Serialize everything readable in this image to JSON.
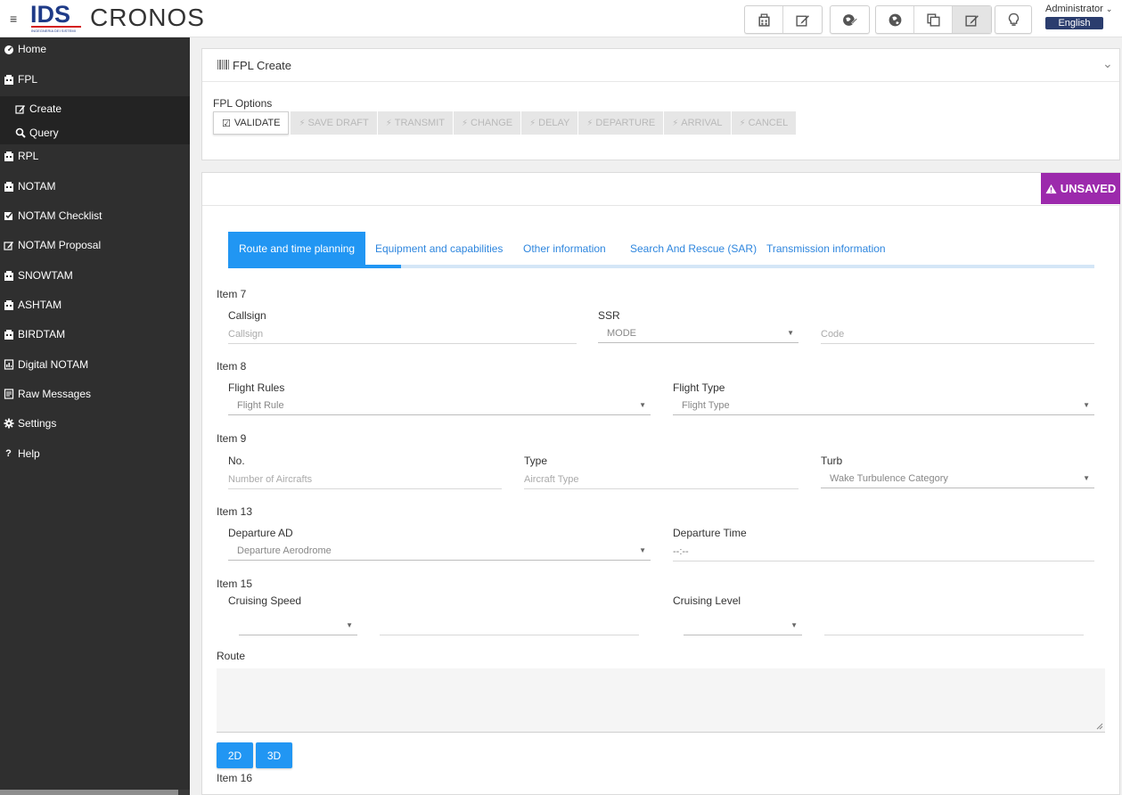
{
  "header": {
    "brand_short": "IDS",
    "brand_sub": "INGEGNERIA DEI SISTEMI",
    "app_name": "CRONOS",
    "user": "Administrator",
    "language": "English",
    "toolbar_icons": [
      "fpl-icon",
      "edit-icon",
      "globe-edit-icon",
      "globe-icon",
      "copy-icon",
      "edit-active-icon",
      "lightbulb-icon"
    ]
  },
  "sidebar": {
    "items": [
      {
        "label": "Home",
        "icon": "dashboard-icon"
      },
      {
        "label": "FPL",
        "icon": "fpl-icon"
      },
      {
        "label": "Create",
        "icon": "edit-icon"
      },
      {
        "label": "Query",
        "icon": "search-icon"
      },
      {
        "label": "RPL",
        "icon": "fpl-icon"
      },
      {
        "label": "NOTAM",
        "icon": "fpl-icon"
      },
      {
        "label": "NOTAM Checklist",
        "icon": "checklist-icon"
      },
      {
        "label": "NOTAM Proposal",
        "icon": "edit-icon"
      },
      {
        "label": "SNOWTAM",
        "icon": "fpl-icon"
      },
      {
        "label": "ASHTAM",
        "icon": "fpl-icon"
      },
      {
        "label": "BIRDTAM",
        "icon": "fpl-icon"
      },
      {
        "label": "Digital NOTAM",
        "icon": "digital-icon"
      },
      {
        "label": "Raw Messages",
        "icon": "document-icon"
      },
      {
        "label": "Settings",
        "icon": "gear-icon"
      },
      {
        "label": "Help",
        "icon": "question-icon"
      }
    ]
  },
  "fpl_panel": {
    "title": "FPL Create",
    "options_label": "FPL Options",
    "buttons": [
      "VALIDATE",
      "SAVE DRAFT",
      "TRANSMIT",
      "CHANGE",
      "DELAY",
      "DEPARTURE",
      "ARRIVAL",
      "CANCEL"
    ]
  },
  "status": {
    "unsaved": "UNSAVED",
    "color": "#9c2aac"
  },
  "tabs": [
    "Route and time planning",
    "Equipment and capabilities",
    "Other information",
    "Search And Rescue (SAR)",
    "Transmission information"
  ],
  "form": {
    "item7": {
      "section": "Item 7",
      "callsign_label": "Callsign",
      "callsign_placeholder": "Callsign",
      "ssr_label": "SSR",
      "ssr_mode": "MODE",
      "code_placeholder": "Code"
    },
    "item8": {
      "section": "Item 8",
      "flight_rules_label": "Flight Rules",
      "flight_rules_value": "Flight Rule",
      "flight_type_label": "Flight Type",
      "flight_type_value": "Flight Type"
    },
    "item9": {
      "section": "Item 9",
      "no_label": "No.",
      "no_placeholder": "Number of Aircrafts",
      "type_label": "Type",
      "type_placeholder": "Aircraft Type",
      "turb_label": "Turb",
      "turb_value": "Wake Turbulence Category"
    },
    "item13": {
      "section": "Item 13",
      "departure_ad_label": "Departure AD",
      "departure_ad_value": "Departure Aerodrome",
      "departure_time_label": "Departure Time",
      "departure_time_value": "--:--"
    },
    "item15": {
      "section": "Item 15",
      "cruising_speed_label": "Cruising Speed",
      "cruising_level_label": "Cruising Level",
      "route_label": "Route"
    },
    "map_buttons": [
      "2D",
      "3D"
    ],
    "item16": {
      "section": "Item 16"
    }
  },
  "colors": {
    "accent": "#2196f3",
    "sidebar": "#2f2f2f",
    "brand": "#1f3b88"
  }
}
